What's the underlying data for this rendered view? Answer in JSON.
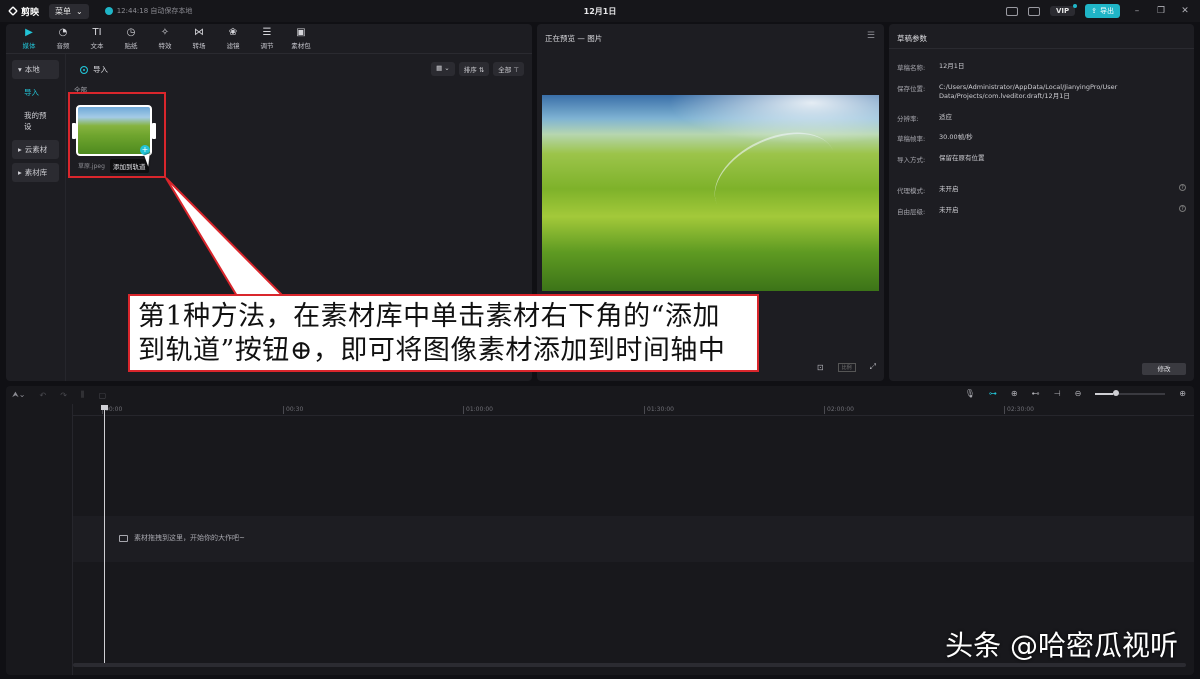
{
  "titlebar": {
    "app_name": "剪映",
    "menu_label": "菜单",
    "save_status": "12:44:18 自动保存本地",
    "doc_title": "12月1日",
    "vip_label": "VIP",
    "export_label": "导出"
  },
  "media_tabs": [
    {
      "label": "媒体",
      "icon": "media-icon"
    },
    {
      "label": "音频",
      "icon": "audio-icon"
    },
    {
      "label": "文本",
      "icon": "text-icon"
    },
    {
      "label": "贴纸",
      "icon": "sticker-icon"
    },
    {
      "label": "特效",
      "icon": "effects-icon"
    },
    {
      "label": "转场",
      "icon": "transition-icon"
    },
    {
      "label": "滤镜",
      "icon": "filter-icon"
    },
    {
      "label": "调节",
      "icon": "adjust-icon"
    },
    {
      "label": "素材包",
      "icon": "package-icon"
    }
  ],
  "sidebar": {
    "local": "本地",
    "import": "导入",
    "presets": "我的预设",
    "cloud": "云素材",
    "library": "素材库"
  },
  "media": {
    "import_label": "导入",
    "sort_label": "排序",
    "filter_label": "全部",
    "all_label": "全部",
    "file_name": "草原.jpeg",
    "tooltip": "添加到轨道",
    "add_symbol": "+"
  },
  "preview": {
    "title": "正在预览 — 图片",
    "ratio_label": "比例"
  },
  "props": {
    "title": "草稿参数",
    "rows": [
      {
        "k": "草稿名称:",
        "v": "12月1日"
      },
      {
        "k": "保存位置:",
        "v": "C:/Users/Administrator/AppData/Local/JianyingPro/User Data/Projects/com.lveditor.draft/12月1日"
      },
      {
        "k": "分辨率:",
        "v": "适应"
      },
      {
        "k": "草稿帧率:",
        "v": "30.00帧/秒"
      },
      {
        "k": "导入方式:",
        "v": "保留在原有位置"
      },
      {
        "k": "代理模式:",
        "v": "未开启"
      },
      {
        "k": "自由层级:",
        "v": "未开启"
      }
    ],
    "edit_label": "修改"
  },
  "timeline": {
    "ticks": [
      "00:00",
      "00:30",
      "01:00:00",
      "01:30:00",
      "02:00:00",
      "02:30:00"
    ],
    "drop_hint": "素材拖拽到这里，开始你的大作吧~"
  },
  "annotation": {
    "line1": "第1种方法，在素材库中单击素材右下角的“添加",
    "line2": "到轨道”按钮⊕，即可将图像素材添加到时间轴中"
  },
  "watermark": "头条 @哈密瓜视听",
  "colors": {
    "accent": "#22c3d6",
    "highlight": "#d9262c"
  }
}
